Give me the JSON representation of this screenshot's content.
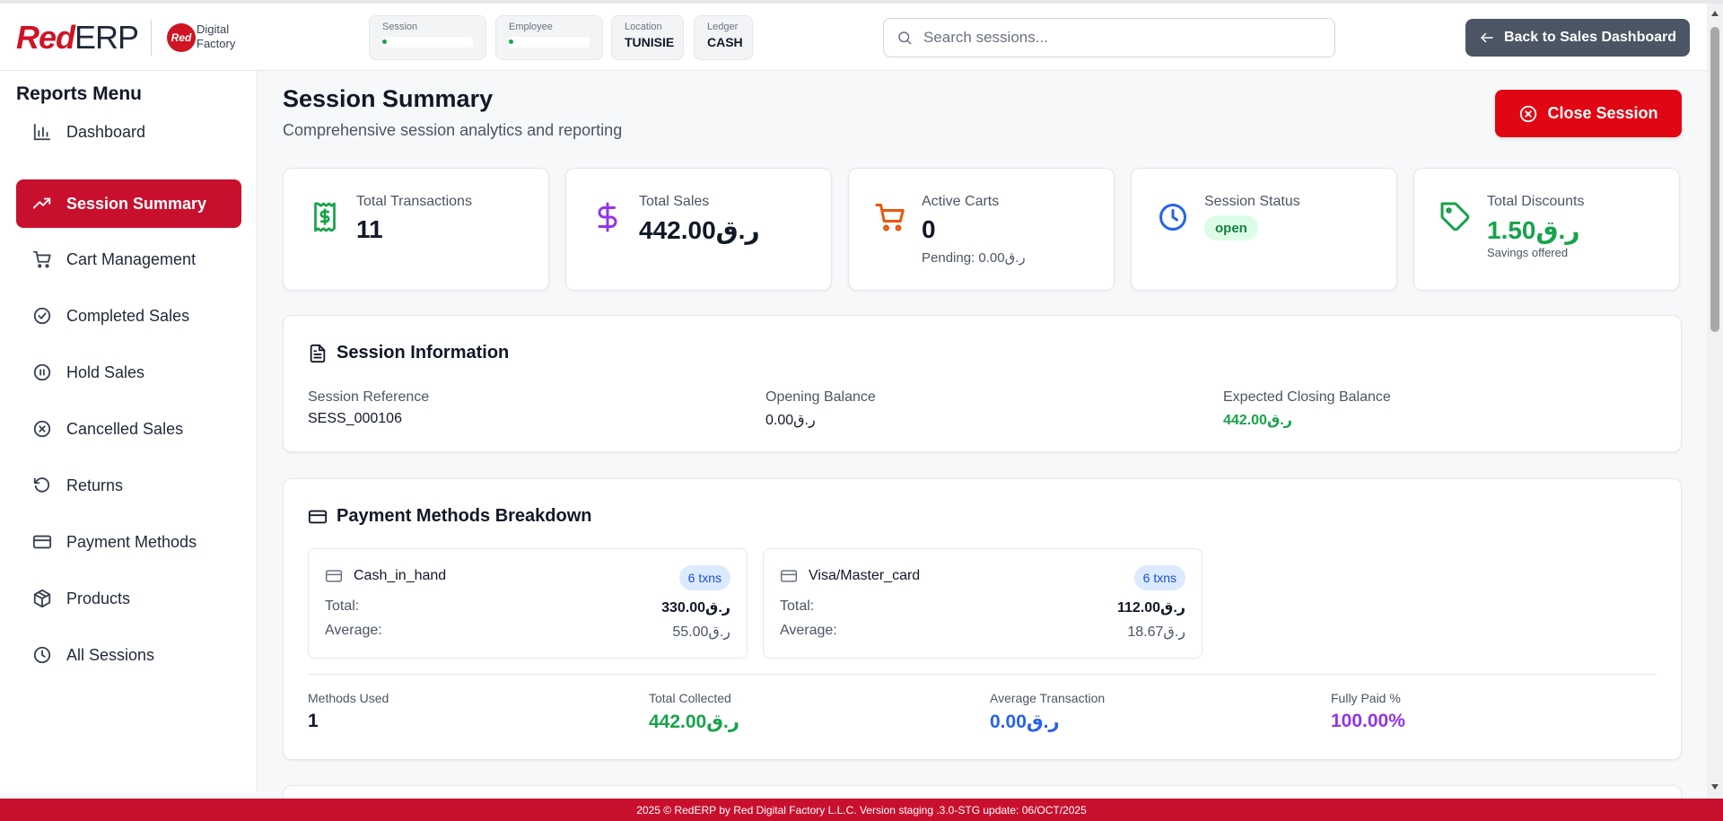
{
  "header": {
    "logo_red": "Red",
    "logo_erp": "ERP",
    "df_badge": "Red",
    "df_line1": "Digital",
    "df_line2": "Factory",
    "chips": [
      {
        "label": "Session",
        "value": ""
      },
      {
        "label": "Employee",
        "value": ""
      },
      {
        "label": "Location",
        "value": "TUNISIE"
      },
      {
        "label": "Ledger",
        "value": "CASH"
      }
    ],
    "search_placeholder": "Search sessions...",
    "back_label": "Back to Sales Dashboard"
  },
  "sidebar": {
    "title": "Reports Menu",
    "items": [
      {
        "label": "Dashboard",
        "icon": "bar-chart-icon"
      },
      {
        "label": "Session Summary",
        "icon": "trending-up-icon",
        "active": true
      },
      {
        "label": "Cart Management",
        "icon": "cart-icon"
      },
      {
        "label": "Completed Sales",
        "icon": "check-circle-icon"
      },
      {
        "label": "Hold Sales",
        "icon": "pause-circle-icon"
      },
      {
        "label": "Cancelled Sales",
        "icon": "x-circle-icon"
      },
      {
        "label": "Returns",
        "icon": "rotate-ccw-icon"
      },
      {
        "label": "Payment Methods",
        "icon": "credit-card-icon"
      },
      {
        "label": "Products",
        "icon": "package-icon"
      },
      {
        "label": "All Sessions",
        "icon": "clock-icon"
      }
    ]
  },
  "main": {
    "title": "Session Summary",
    "subtitle": "Comprehensive session analytics and reporting",
    "close_label": "Close Session",
    "stats": [
      {
        "label": "Total Transactions",
        "value": "11",
        "icon": "receipt-dollar-icon",
        "color": "#16a34a"
      },
      {
        "label": "Total Sales",
        "value": "442.00ر.ق",
        "icon": "dollar-icon",
        "color": "#9333ea"
      },
      {
        "label": "Active Carts",
        "value": "0",
        "sub": "Pending: 0.00ر.ق",
        "icon": "cart-icon",
        "color": "#ea580c"
      },
      {
        "label": "Session Status",
        "value": "open",
        "icon": "clock-icon",
        "color": "#2563eb"
      },
      {
        "label": "Total Discounts",
        "value": "1.50ر.ق",
        "sub": "Savings offered",
        "icon": "tag-icon",
        "color": "#16a34a"
      }
    ],
    "session_info": {
      "title": "Session Information",
      "fields": [
        {
          "label": "Session Reference",
          "value": "SESS_000106"
        },
        {
          "label": "Opening Balance",
          "value": "0.00ر.ق"
        },
        {
          "label": "Expected Closing Balance",
          "value": "442.00ر.ق"
        }
      ]
    },
    "payment": {
      "title": "Payment Methods Breakdown",
      "methods": [
        {
          "name": "Cash_in_hand",
          "txns": "6 txns",
          "total_label": "Total:",
          "total": "330.00ر.ق",
          "avg_label": "Average:",
          "avg": "55.00ر.ق"
        },
        {
          "name": "Visa/Master_card",
          "txns": "6 txns",
          "total_label": "Total:",
          "total": "112.00ر.ق",
          "avg_label": "Average:",
          "avg": "18.67ر.ق"
        }
      ],
      "summary": [
        {
          "label": "Methods Used",
          "value": "1",
          "color": "#111827"
        },
        {
          "label": "Total Collected",
          "value": "442.00ر.ق",
          "color": "#16a34a"
        },
        {
          "label": "Average Transaction",
          "value": "0.00ر.ق",
          "color": "#2563eb"
        },
        {
          "label": "Fully Paid %",
          "value": "100.00%",
          "color": "#9333ea"
        }
      ]
    }
  },
  "footer": {
    "text": "2025 © RedERP by Red Digital Factory L.L.C. Version staging .3.0-STG update: 06/OCT/2025"
  }
}
